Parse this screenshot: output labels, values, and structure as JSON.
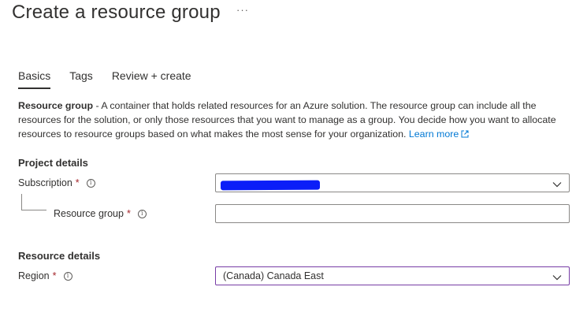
{
  "page": {
    "title": "Create a resource group",
    "more": "···"
  },
  "tabs": [
    {
      "label": "Basics",
      "active": true
    },
    {
      "label": "Tags",
      "active": false
    },
    {
      "label": "Review + create",
      "active": false
    }
  ],
  "description": {
    "term": "Resource group",
    "text": " - A container that holds related resources for an Azure solution. The resource group can include all the resources for the solution, or only those resources that you want to manage as a group. You decide how you want to allocate resources to resource groups based on what makes the most sense for your organization. ",
    "link_label": "Learn more",
    "link_icon": "external-link-icon"
  },
  "project_details": {
    "title": "Project details",
    "subscription": {
      "label": "Subscription",
      "required_mark": "*",
      "info_icon": "info-icon",
      "value_redacted": true,
      "control": "dropdown"
    },
    "resource_group": {
      "label": "Resource group",
      "required_mark": "*",
      "info_icon": "info-icon",
      "value": "",
      "control": "text-input"
    }
  },
  "resource_details": {
    "title": "Resource details",
    "region": {
      "label": "Region",
      "required_mark": "*",
      "info_icon": "info-icon",
      "value": "(Canada) Canada East",
      "control": "dropdown"
    }
  },
  "colors": {
    "text": "#323130",
    "link": "#0078d4",
    "required": "#a4262c",
    "focus_border": "#773ca5",
    "redaction": "#0b1ef8"
  }
}
